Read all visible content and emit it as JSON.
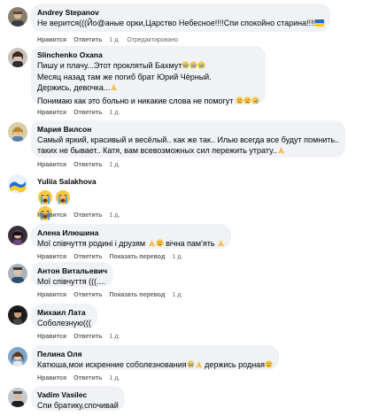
{
  "labels": {
    "like": "Нравится",
    "reply": "Ответить",
    "translate": "Показать перевод",
    "edited": "Отредактировано"
  },
  "comments": [
    {
      "author": "Andrey Stepanov",
      "lines": [
        "Не верится(((Йо@аные орки,Царство Небесное!!!!Спи спокойно старина!!!!"
      ],
      "flag_emoji": "ukraine-flag",
      "time": "1 д.",
      "edited": true,
      "translate": false
    },
    {
      "author": "Slinchenko Oxana",
      "lines": [
        "Пишу и плачу...Этот проклятый Бахмут",
        "Месяц назад там же погиб брат Юрий Чёрный.",
        "Держись, девочка...",
        "Понимаю как это больно и никакие слова не помогут"
      ],
      "time": "1 д.",
      "translate": false
    },
    {
      "author": "Мария Вилсон",
      "lines": [
        "Самый яркий, красивый и весёлый.. как же так.. Илью всегда все будут помнить..",
        "таких не бывает.. Катя, вам всевозможных сил пережить утрату.."
      ],
      "time": "1 д.",
      "translate": false
    },
    {
      "author": "Yuliia Salakhova",
      "lines": [],
      "big_emojis": [
        "crying-face",
        "crying-face",
        "crying-face"
      ],
      "time": "1 д.",
      "translate": false
    },
    {
      "author": "Алена Илюшина",
      "lines": [
        "Мої співчуття родині і друзям",
        "вічна пам'ять"
      ],
      "time": "1 д.",
      "translate": true
    },
    {
      "author": "Антон Витальевич",
      "lines": [
        "Мої співчуття (((...."
      ],
      "time": "1 д.",
      "translate": true
    },
    {
      "author": "Михаил Лата",
      "lines": [
        "Соболезную((("
      ],
      "time": "1 д.",
      "translate": false
    },
    {
      "author": "Пелина Оля",
      "lines": [
        "Катюша,мои искренние соболезнования",
        "держись родная"
      ],
      "time": "1 д.",
      "translate": false
    },
    {
      "author": "Vadim Vasilec",
      "lines": [
        "Спи братику,спочивай"
      ],
      "time": "",
      "translate": false
    }
  ]
}
